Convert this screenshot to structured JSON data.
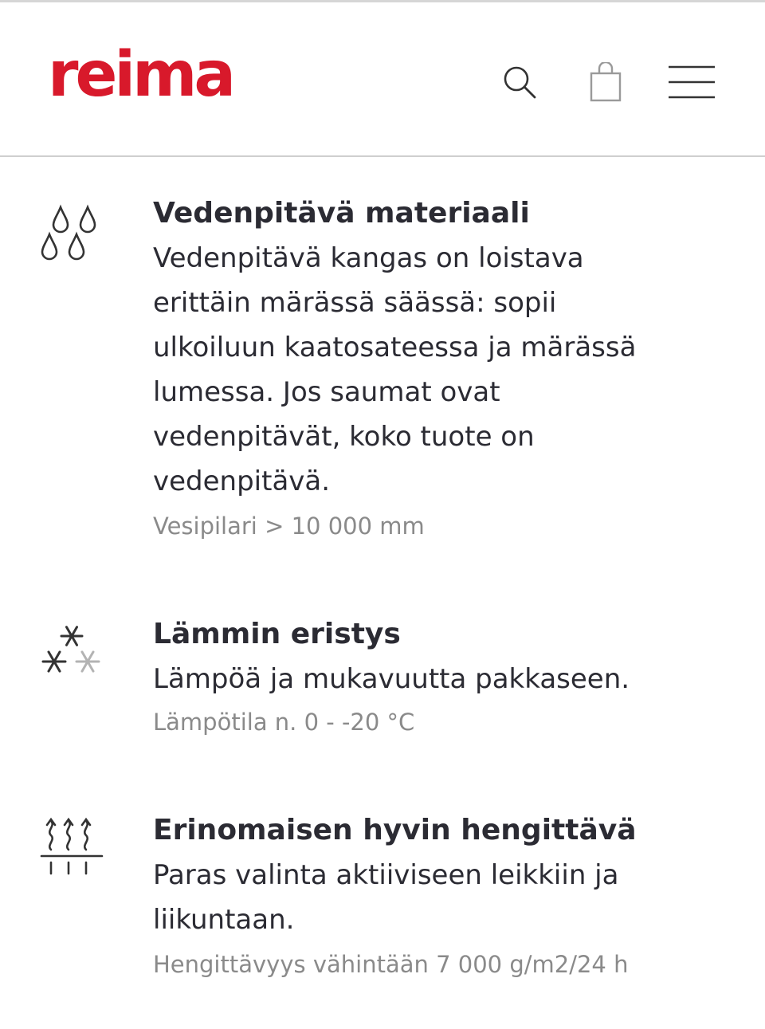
{
  "header": {
    "logo_text": "reima",
    "brand_color": "#d8192b",
    "icons": [
      "search-icon",
      "shopping-bag-icon",
      "menu-icon"
    ]
  },
  "features": [
    {
      "icon": "water-drops-icon",
      "title": "Vedenpitävä materiaali",
      "description_lines": [
        "Vedenpitävä kangas on loistava",
        "erittäin märässä säässä: sopii",
        "ulkoiluun kaatosateessa ja märässä",
        "lumessa. Jos saumat ovat",
        "vedenpitävät, koko tuote on",
        "vedenpitävä."
      ],
      "meta": "Vesipilari > 10 000 mm"
    },
    {
      "icon": "snowflakes-icon",
      "title": "Lämmin eristys",
      "description_lines": [
        "Lämpöä ja mukavuutta pakkaseen."
      ],
      "meta": "Lämpötila n. 0 - -20 °C"
    },
    {
      "icon": "breathable-icon",
      "title": "Erinomaisen hyvin hengittävä",
      "description_lines": [
        "Paras valinta aktiiviseen leikkiin ja",
        "liikuntaan."
      ],
      "meta": "Hengittävyys vähintään 7 000 g/m2/24 h"
    }
  ]
}
